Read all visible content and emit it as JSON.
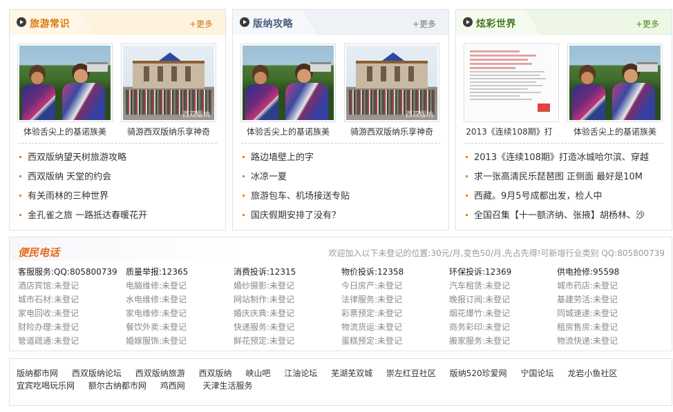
{
  "panels": [
    {
      "title": "旅游常识",
      "title_color": "#e0760c",
      "more": "+更多",
      "thumbs": [
        {
          "caption": "体验舌尖上的基诺族美"
        },
        {
          "caption": "骑游西双版纳乐享神奇",
          "watermark": "西双版纳"
        }
      ],
      "news": [
        "西双版纳望天树旅游攻略",
        "西双版纳 天堂的约会",
        "有关雨林的三种世界",
        "金孔雀之旅 一路抵达春暖花开"
      ]
    },
    {
      "title": "版纳攻略",
      "title_color": "#4a5e7e",
      "more": "+更多",
      "thumbs": [
        {
          "caption": "体验舌尖上的基诺族美"
        },
        {
          "caption": "骑游西双版纳乐享神奇",
          "watermark": "西双版纳"
        }
      ],
      "news": [
        "路边墙壁上的字",
        "冰凉一夏",
        "旅游包车、机场接送专贴",
        "国庆假期安排了没有？"
      ]
    },
    {
      "title": "炫彩世界",
      "title_color": "#3f7a1a",
      "more": "+更多",
      "thumbs": [
        {
          "caption": "2013《连续108期》打"
        },
        {
          "caption": "体验舌尖上的基诺族美"
        }
      ],
      "news": [
        "2013《连续108期》打造冰城哈尔滨、穿越",
        "求一张高清民乐琵琶图 正侧面 最好是10M",
        "西藏。9月5号成都出发，检人中",
        "全国召集【十一额济纳、张掖】胡杨林、沙"
      ]
    }
  ],
  "phone": {
    "title": "便民电话",
    "notice": "欢迎加入以下未登记的位置:30元/月,变色50/月,先占先得!可新增行业类别 QQ:805800739",
    "columns": [
      [
        "客服服务:QQ:805800739",
        "酒店宾馆:未登记",
        "城市石材:未登记",
        "家电回收:未登记",
        "财险办理:未登记",
        "管道疏通:未登记"
      ],
      [
        "质量举报:12365",
        "电脑维修:未登记",
        "水电维修:未登记",
        "家电维修:未登记",
        "餐饮外卖:未登记",
        "婚嫁服饰:未登记"
      ],
      [
        "消费投诉:12315",
        "婚纱摄影:未登记",
        "网站制作:未登记",
        "婚庆庆典:未登记",
        "快递服务:未登记",
        "鲜花预定:未登记"
      ],
      [
        "物价投诉:12358",
        "今日房产:未登记",
        "法律服务:未登记",
        "彩票预定:未登记",
        "物流货运:未登记",
        "蛋糕预定:未登记"
      ],
      [
        "环保投诉:12369",
        "汽车租赁:未登记",
        "晚报订阅:未登记",
        "烟花爆竹:未登记",
        "商务彩印:未登记",
        "搬家服务:未登记"
      ],
      [
        "供电抢修:95598",
        "城市药店:未登记",
        "基建劳活:未登记",
        "同城速递:未登记",
        "租房售房:未登记",
        "物流快递:未登记"
      ]
    ]
  },
  "links": [
    "版纳都市网",
    "西双版纳论坛",
    "西双版纳旅游",
    "西双版纳",
    "峡山吧",
    "江油论坛",
    "芜湖芜双城",
    "崇左红豆社区",
    "版纳520珍爱网",
    "宁国论坛",
    "龙岩小鱼社区",
    "宜宾吃喝玩乐网",
    "额尔古纳都市网",
    "鸡西网",
    "天津生活服务"
  ],
  "colors": {
    "accent_orange": "#e56a1a",
    "bullet": "#e57c1d",
    "border": "#e2e2e2"
  }
}
